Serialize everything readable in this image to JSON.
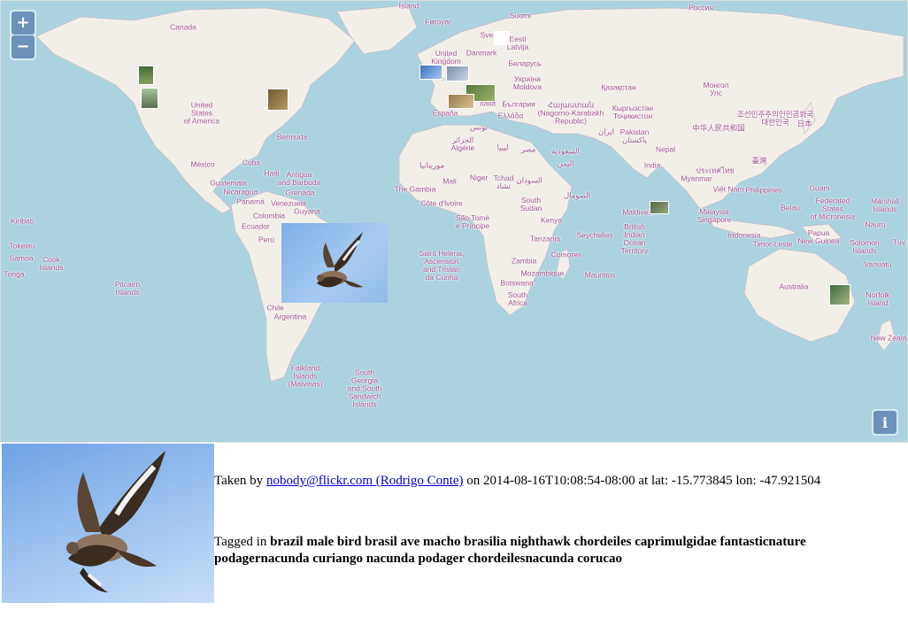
{
  "map": {
    "zoom_in_label": "+",
    "zoom_out_label": "−",
    "info_label": "i",
    "labels": {
      "canada": "Canada",
      "usa": "United\nStates\nof America",
      "mexico": "México",
      "cuba": "Cuba",
      "haiti": "Haiti",
      "antigua": "Antigua\nand Barbuda",
      "grenada": "Grenada",
      "guatemala": "Guatemala",
      "nicaragua": "Nicaragua",
      "panama": "Panamá",
      "venezuela": "Venezuela",
      "guyana": "Guyana",
      "colombia": "Colombia",
      "ecuador": "Ecuador",
      "peru": "Perú",
      "chile": "Chile",
      "argentina": "Argentina",
      "bermuda": "Bermuda",
      "falkland": "Falkland\nIslands\n(Malvinas)",
      "south_georgia": "South\nGeorgia\nand South\nSandwich\nIslands",
      "kiribati": "Kiribati",
      "tokelau": "Tokelau",
      "samoa": "Samoa",
      "cook": "Cook\nIslands",
      "tonga": "Tonga",
      "pitcairn": "Pitcairn\nIslands",
      "island": "Ísland",
      "faroe": "Føroyar",
      "uk": "United\nKingdom",
      "danmark": "Danmark",
      "suomi": "Suomi",
      "eesti": "Eesti\nLatvija",
      "belarus": "Беларусь",
      "ukraine": "Україна\nMoldova",
      "espana": "España",
      "italia": "Italia",
      "bulgaria": "България",
      "greece": "Ελλάδα",
      "armenia": "Հայաստան\n(Nagorno-Karabakh\nRepublic)",
      "tunisia": "تونس",
      "algeria": "الجزائر\nAlgérie",
      "egypt": "مصر",
      "libya": "ليبيا",
      "mauritanie": "موريتانيا",
      "mali": "Mali",
      "niger": "Niger",
      "tchad": "Tchad\nتشاد",
      "sudan": "السودان",
      "gambia": "The Gambia",
      "cote_divoire": "Côte d'Ivoire",
      "sao_tome": "São Tomé\ne Príncipe",
      "south_sudan": "South\nSudan",
      "kenya": "Kenya",
      "somalia": "الصومال",
      "tanzania": "Tanzania",
      "zambia": "Zambia",
      "mozambique": "Mozambique",
      "botswana": "Botswana",
      "south_africa": "South\nAfrica",
      "comores": "Comores",
      "seychelles": "Seychelles",
      "mauritius": "Mauritius",
      "st_helena": "Saint Helena,\nAscension\nand Tristan\nda Cunha",
      "saudi": "السعودية",
      "yemen": "اليمن",
      "iran": "ایران",
      "pakistan": "Pakistan\nپاکستان",
      "india": "India",
      "nepal": "Nepal",
      "kazakhstan": "Қазақстан",
      "kyrgyzstan": "Кыргызстан\nТоҷикистон",
      "mongolia": "Монгол\nУлс",
      "china": "中华人民共和国",
      "korea": "조선민주주의인민공화국\n대한민국",
      "japan": "日本",
      "taiwan": "臺灣",
      "myanmar": "Myanmar",
      "thailand": "ประเทศไทย",
      "vietnam": "Việt Nam",
      "philippines": "Philippines",
      "malaysia": "Malaysia\nSingapore",
      "indonesia": "Indonesia",
      "timor": "Timor-Leste",
      "maldives": "Maldives",
      "biot": "British\nIndian\nOcean\nTerritory",
      "guam": "Guam",
      "micronesia": "Federated\nStates\nof Micronesia",
      "marshall": "Marshall\nIslands",
      "belau": "Belau",
      "nauru": "Nauru",
      "png": "Papua\nNew Guinea",
      "solomon": "Solomon\nIslands",
      "vanuatu": "Vanuatu",
      "tuvalu": "Tuv",
      "australia": "Australia",
      "norfolk": "Norfolk\nIsland",
      "new_zealand": "New Zeala",
      "rossiya": "Россия",
      "sverige": "Sve"
    },
    "featured_photo_alt": "Nighthawk in flight"
  },
  "detail": {
    "taken_by_prefix": "Taken by",
    "author_link": "nobody@flickr.com (Rodrigo Conte)",
    "on_text": "on 2014-08-16T10:08:54-08:00 at lat: -15.773845 lon: -47.921504",
    "tagged_prefix": "Tagged in",
    "tags": "brazil male bird brasil ave macho brasilia nighthawk chordeiles caprimulgidae fantasticnature podagernacunda curiango nacunda podager chordeilesnacunda corucao"
  }
}
